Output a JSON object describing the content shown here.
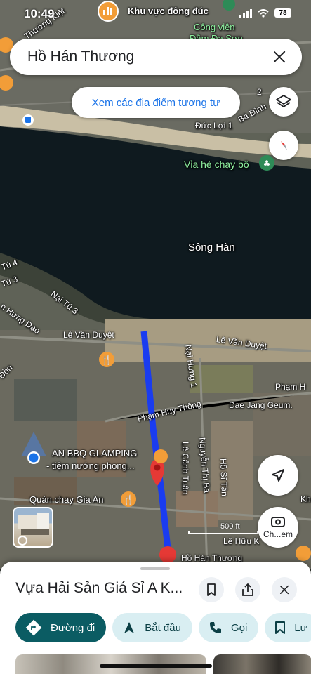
{
  "status": {
    "time": "10:49",
    "battery": "78"
  },
  "search": {
    "query": "Hồ Hán Thương"
  },
  "buttons": {
    "similar_places": "Xem các địa điểm tương tự",
    "checkin_label": "Ch...em"
  },
  "map": {
    "labels": {
      "crowded_area": "Khu vực đông đúc",
      "park_line1": "Công viên",
      "park_line2": "Đầm Đa Sơn",
      "thuong_kiet": "Thường Kiệt",
      "ba_dinh": "Bà Đình",
      "duc_loi": "Đức Lợi 1",
      "street_2": "2",
      "running_path": "Vỉa hè chạy bộ",
      "song_han": "Sông Hàn",
      "nai_tu_4": "Tú 4",
      "nai_tu_3_left": "Tú 3",
      "nai_tu_3": "Nại Tú 3",
      "hung_dao": "n Hưng Đạo",
      "le_van_duyet_left": "Lê Văn Duyệt",
      "le_van_duyet_right": "Lê Văn Duyệt",
      "don": "Đồn",
      "nai_hung": "Nại Hưng 1",
      "pham_huy_thong": "Phạm Huy Thông",
      "pham_h": "Phạm H",
      "dae_jang_geum": "Dae Jang Geum.",
      "an_bbq": "AN BBQ GLAMPING",
      "an_bbq_sub": "- tiệm nướng phong...",
      "quan_chay": "Quán chay Gia An",
      "le_canh_tuan": "Lê Cảnh Tuân",
      "nguyen_thi_ba": "Nguyễn Thị Ba",
      "ho_si_tan": "Hồ Sĩ Tân",
      "le_huu_k": "Lê Hữu K",
      "ho_han_thuong_map": "Hồ Hán Thương",
      "kh": "Kh"
    },
    "scale": "500 ft"
  },
  "place": {
    "title": "Vựa Hải Sản Giá Sỉ A K...",
    "actions": {
      "directions": "Đường đi",
      "start": "Bắt đầu",
      "call": "Gọi",
      "save": "Lư"
    }
  },
  "colors": {
    "route": "#1a3cf0",
    "pin": "#e53935",
    "primary_action": "#0b5c63",
    "secondary_action": "#d9eef2",
    "link_blue": "#1a73e8"
  }
}
